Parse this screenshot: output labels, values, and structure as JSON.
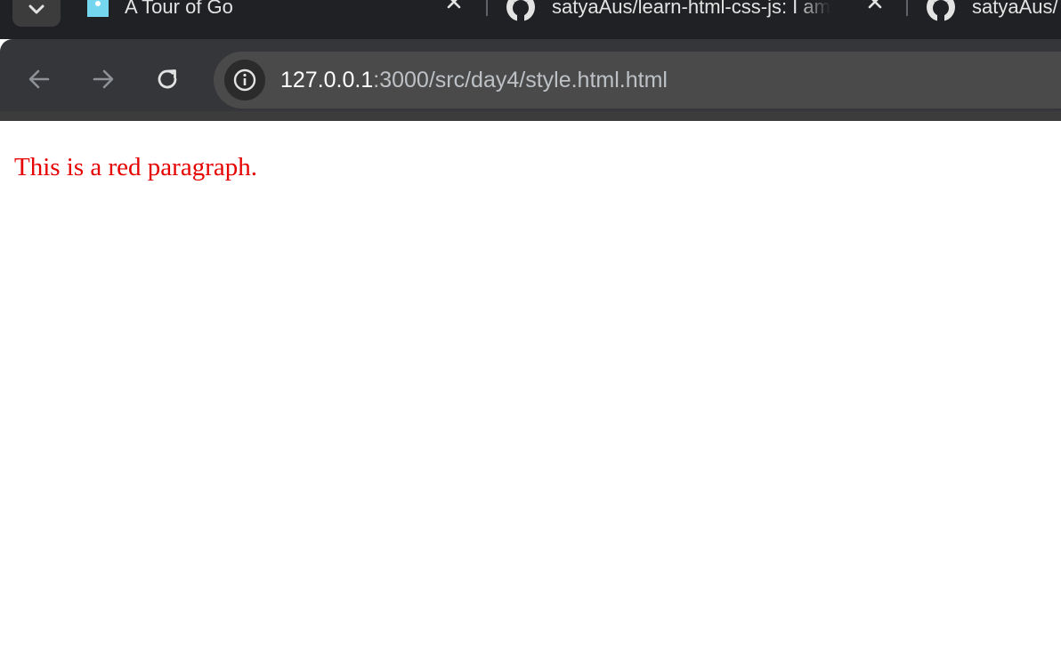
{
  "tabs": [
    {
      "title": "A Tour of Go",
      "favicon": "go-gopher-icon"
    },
    {
      "title": "satyaAus/learn-html-css-js: I am",
      "favicon": "github-icon"
    },
    {
      "title": "satyaAus/",
      "favicon": "github-icon"
    }
  ],
  "omnibox": {
    "url_host": "127.0.0.1",
    "url_path": ":3000/src/day4/style.html.html",
    "site_info_icon": "info-icon"
  },
  "page": {
    "paragraph": "This is a red paragraph.",
    "paragraph_color": "#e60000"
  },
  "colors": {
    "tabstrip_bg": "#202124",
    "toolbar_bg": "#35363a",
    "omnibox_bg": "#4a4a4a"
  }
}
